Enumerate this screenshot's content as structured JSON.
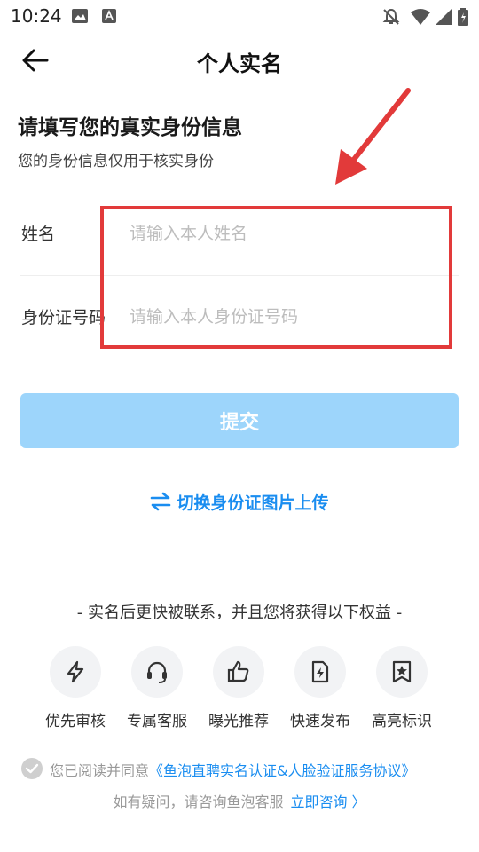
{
  "status": {
    "time": "10:24"
  },
  "header": {
    "title": "个人实名"
  },
  "intro": {
    "heading": "请填写您的真实身份信息",
    "subheading": "您的身份信息仅用于核实身份"
  },
  "form": {
    "name": {
      "label": "姓名",
      "placeholder": "请输入本人姓名",
      "value": ""
    },
    "id_number": {
      "label": "身份证号码",
      "placeholder": "请输入本人身份证号码",
      "value": ""
    },
    "submit_label": "提交"
  },
  "switch_upload": {
    "label": "切换身份证图片上传"
  },
  "benefits": {
    "title": "- 实名后更快被联系，并且您将获得以下权益 -",
    "items": [
      {
        "icon": "lightning-icon",
        "label": "优先审核"
      },
      {
        "icon": "headset-icon",
        "label": "专属客服"
      },
      {
        "icon": "thumbs-up-icon",
        "label": "曝光推荐"
      },
      {
        "icon": "quick-publish-icon",
        "label": "快速发布"
      },
      {
        "icon": "bookmark-star-icon",
        "label": "高亮标识"
      }
    ]
  },
  "agreement": {
    "prefix": "您已阅读并同意",
    "link": "《鱼泡直聘实名认证&人脸验证服务协议》",
    "checked": false
  },
  "help": {
    "text": "如有疑问，请咨询鱼泡客服",
    "link": "立即咨询 〉"
  },
  "colors": {
    "accent": "#1a8df0",
    "submit_disabled": "#9dd5fb",
    "annotation_red": "#e23a3a"
  }
}
